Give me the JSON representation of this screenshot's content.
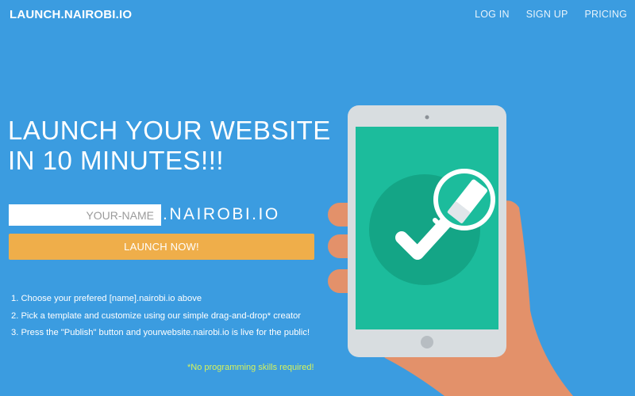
{
  "header": {
    "brand": "LAUNCH.NAIROBI.IO",
    "nav": [
      {
        "label": "LOG IN"
      },
      {
        "label": "SIGN UP"
      },
      {
        "label": "PRICING"
      }
    ]
  },
  "hero": {
    "headline_line1": "LAUNCH YOUR WEBSITE",
    "headline_line2": "IN 10 MINUTES!!!",
    "name_input": {
      "placeholder": "YOUR-NAME",
      "value": ""
    },
    "domain_suffix": ".NAIROBI.IO",
    "launch_button": "LAUNCH NOW!"
  },
  "steps": [
    "1. Choose your prefered [name].nairobi.io above",
    "2. Pick a template and customize using our simple drag-and-drop* creator",
    "3. Press the \"Publish\" button and yourwebsite.nairobi.io is live for the public!"
  ],
  "note": "*No programming skills required!",
  "illustration": {
    "icons": [
      "hand-icon",
      "tablet-icon",
      "checkmark-icon",
      "magnifier-icon"
    ]
  },
  "colors": {
    "background": "#3b9ce0",
    "button": "#efae4a",
    "screen": "#1cbc9c",
    "note": "#d6f25a"
  }
}
